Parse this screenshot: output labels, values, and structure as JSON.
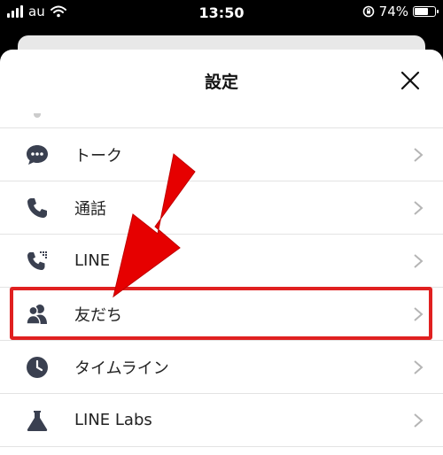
{
  "status_bar": {
    "carrier": "au",
    "time": "13:50",
    "battery_percent": "74%",
    "battery_level": 0.74
  },
  "sheet": {
    "title": "設定",
    "close_icon": "close-icon"
  },
  "settings_list": {
    "items": [
      {
        "label": "トーク",
        "icon": "chat-bubble-icon"
      },
      {
        "label": "通話",
        "icon": "phone-icon"
      },
      {
        "label": "LINE",
        "icon": "line-out-phone-icon"
      },
      {
        "label": "友だち",
        "icon": "friends-icon"
      },
      {
        "label": "タイムライン",
        "icon": "clock-icon"
      },
      {
        "label": "LINE Labs",
        "icon": "flask-icon"
      }
    ],
    "highlighted_item": "友だち"
  },
  "annotation": {
    "arrow_color": "#e60000",
    "highlight_color": "#e02020"
  }
}
